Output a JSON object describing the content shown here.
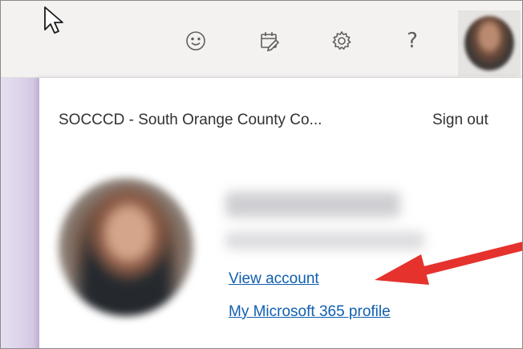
{
  "header": {
    "icons": [
      {
        "name": "smiley-icon",
        "label": "Feedback"
      },
      {
        "name": "my-day-icon",
        "label": "My Day"
      },
      {
        "name": "settings-icon",
        "label": "Settings"
      },
      {
        "name": "help-icon",
        "glyph": "?"
      }
    ]
  },
  "account": {
    "organization": "SOCCCD - South Orange County Co...",
    "sign_out_label": "Sign out",
    "view_account_label": "View account",
    "m365_profile_label": "My Microsoft 365 profile"
  },
  "annotation": {
    "arrow_color": "#e5322d"
  },
  "colors": {
    "header_bg": "#f3f2f1",
    "link": "#0f5faf",
    "text": "#323130",
    "icon": "#605e5c"
  }
}
